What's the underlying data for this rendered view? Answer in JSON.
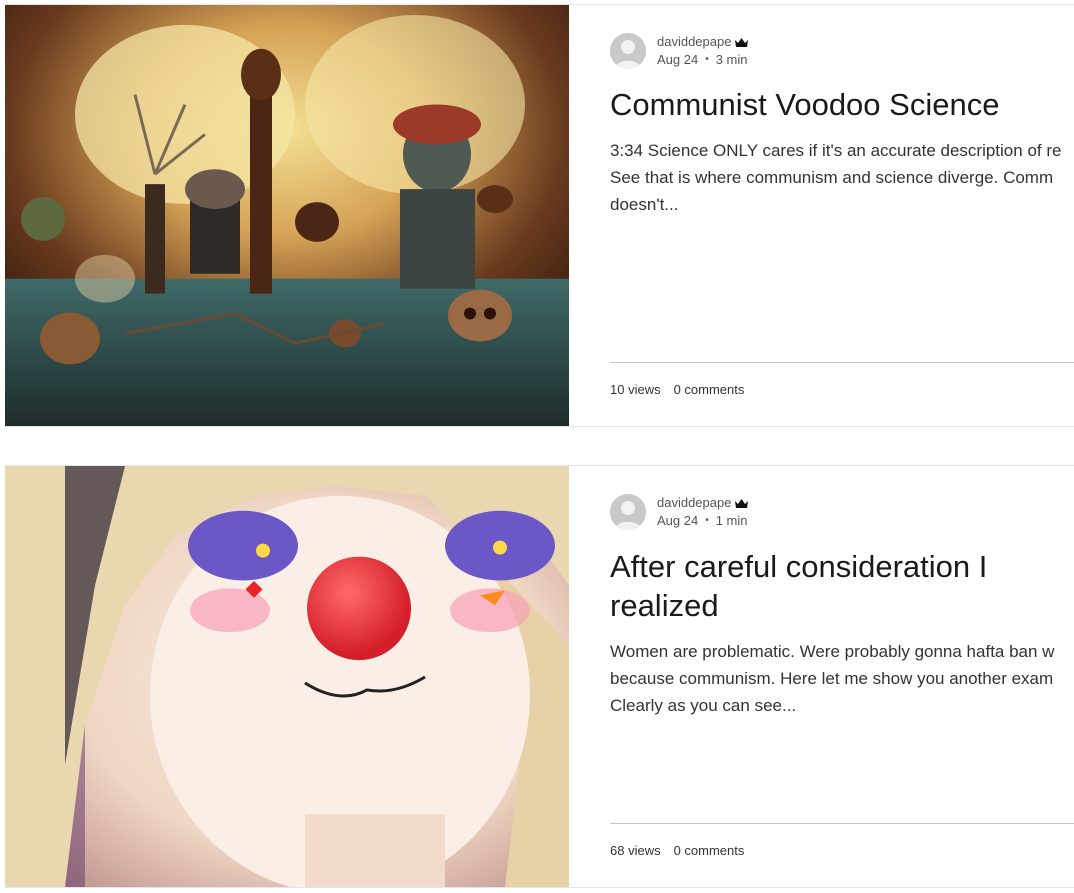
{
  "posts": [
    {
      "author": "daviddepape",
      "author_badge": "crown-icon",
      "date": "Aug 24",
      "read_time": "3 min",
      "title": "Communist Voodoo Science",
      "excerpt_lines": [
        "3:34 Science ONLY cares if it's an accurate description of re",
        "See that is where communism and science diverge. Comm",
        "doesn't..."
      ],
      "views": "10 views",
      "comments": "0 comments",
      "cover_icon": "voodoo-science-illustration"
    },
    {
      "author": "daviddepape",
      "author_badge": "crown-icon",
      "date": "Aug 24",
      "read_time": "1 min",
      "title": "After careful consideration I realized",
      "excerpt_lines": [
        "Women are problematic. Were probably gonna hafta ban w",
        "because communism. Here let me show you another exam",
        "Clearly as you can see..."
      ],
      "views": "68 views",
      "comments": "0 comments",
      "cover_icon": "anime-clown-girl-illustration"
    }
  ]
}
